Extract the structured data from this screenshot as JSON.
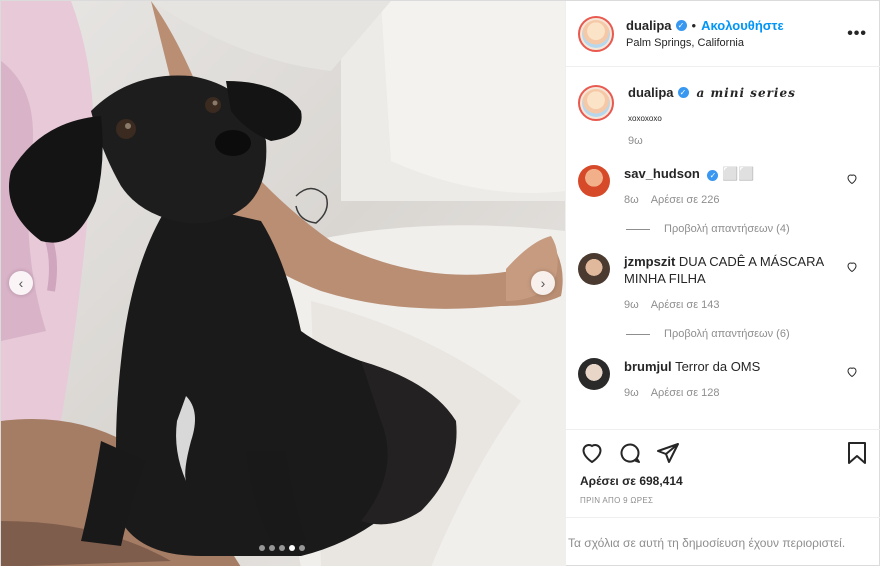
{
  "post": {
    "username": "dualipa",
    "follow_label": "Ακολουθήστε",
    "separator": "•",
    "location": "Palm Springs, California",
    "more_icon": "more-horizontal-icon"
  },
  "caption": {
    "username": "dualipa",
    "text": "a mini series",
    "subtext": "xoxoxoxo",
    "time": "9ω"
  },
  "comments": [
    {
      "username": "sav_hudson",
      "text": "⬜⬜",
      "time": "8ω",
      "likes": "Αρέσει σε 226",
      "replies": "Προβολή απαντήσεων (4)",
      "verified": true
    },
    {
      "username": "jzmpszit",
      "text": "DUA CADÊ A MÁSCARA MINHA FILHA",
      "time": "9ω",
      "likes": "Αρέσει σε 143",
      "replies": "Προβολή απαντήσεων (6)",
      "verified": false
    },
    {
      "username": "brumjul",
      "text": "Terror da OMS",
      "time": "9ω",
      "likes": "Αρέσει σε 128",
      "replies": "",
      "verified": false
    }
  ],
  "actions": {
    "likes": "Αρέσει σε 698,414",
    "ago": "ΠΡΙΝ ΑΠΟ 9 ΩΡΕΣ",
    "icons": [
      "heart-icon",
      "comment-icon",
      "share-icon",
      "bookmark-icon"
    ]
  },
  "restricted_text": "Τα σχόλια σε αυτή τη δημοσίευση έχουν περιοριστεί.",
  "carousel": {
    "current": 4,
    "total": 5
  },
  "colors": {
    "link": "#0095f6",
    "verified": "#3897f0",
    "muted": "#8e8e8e"
  }
}
